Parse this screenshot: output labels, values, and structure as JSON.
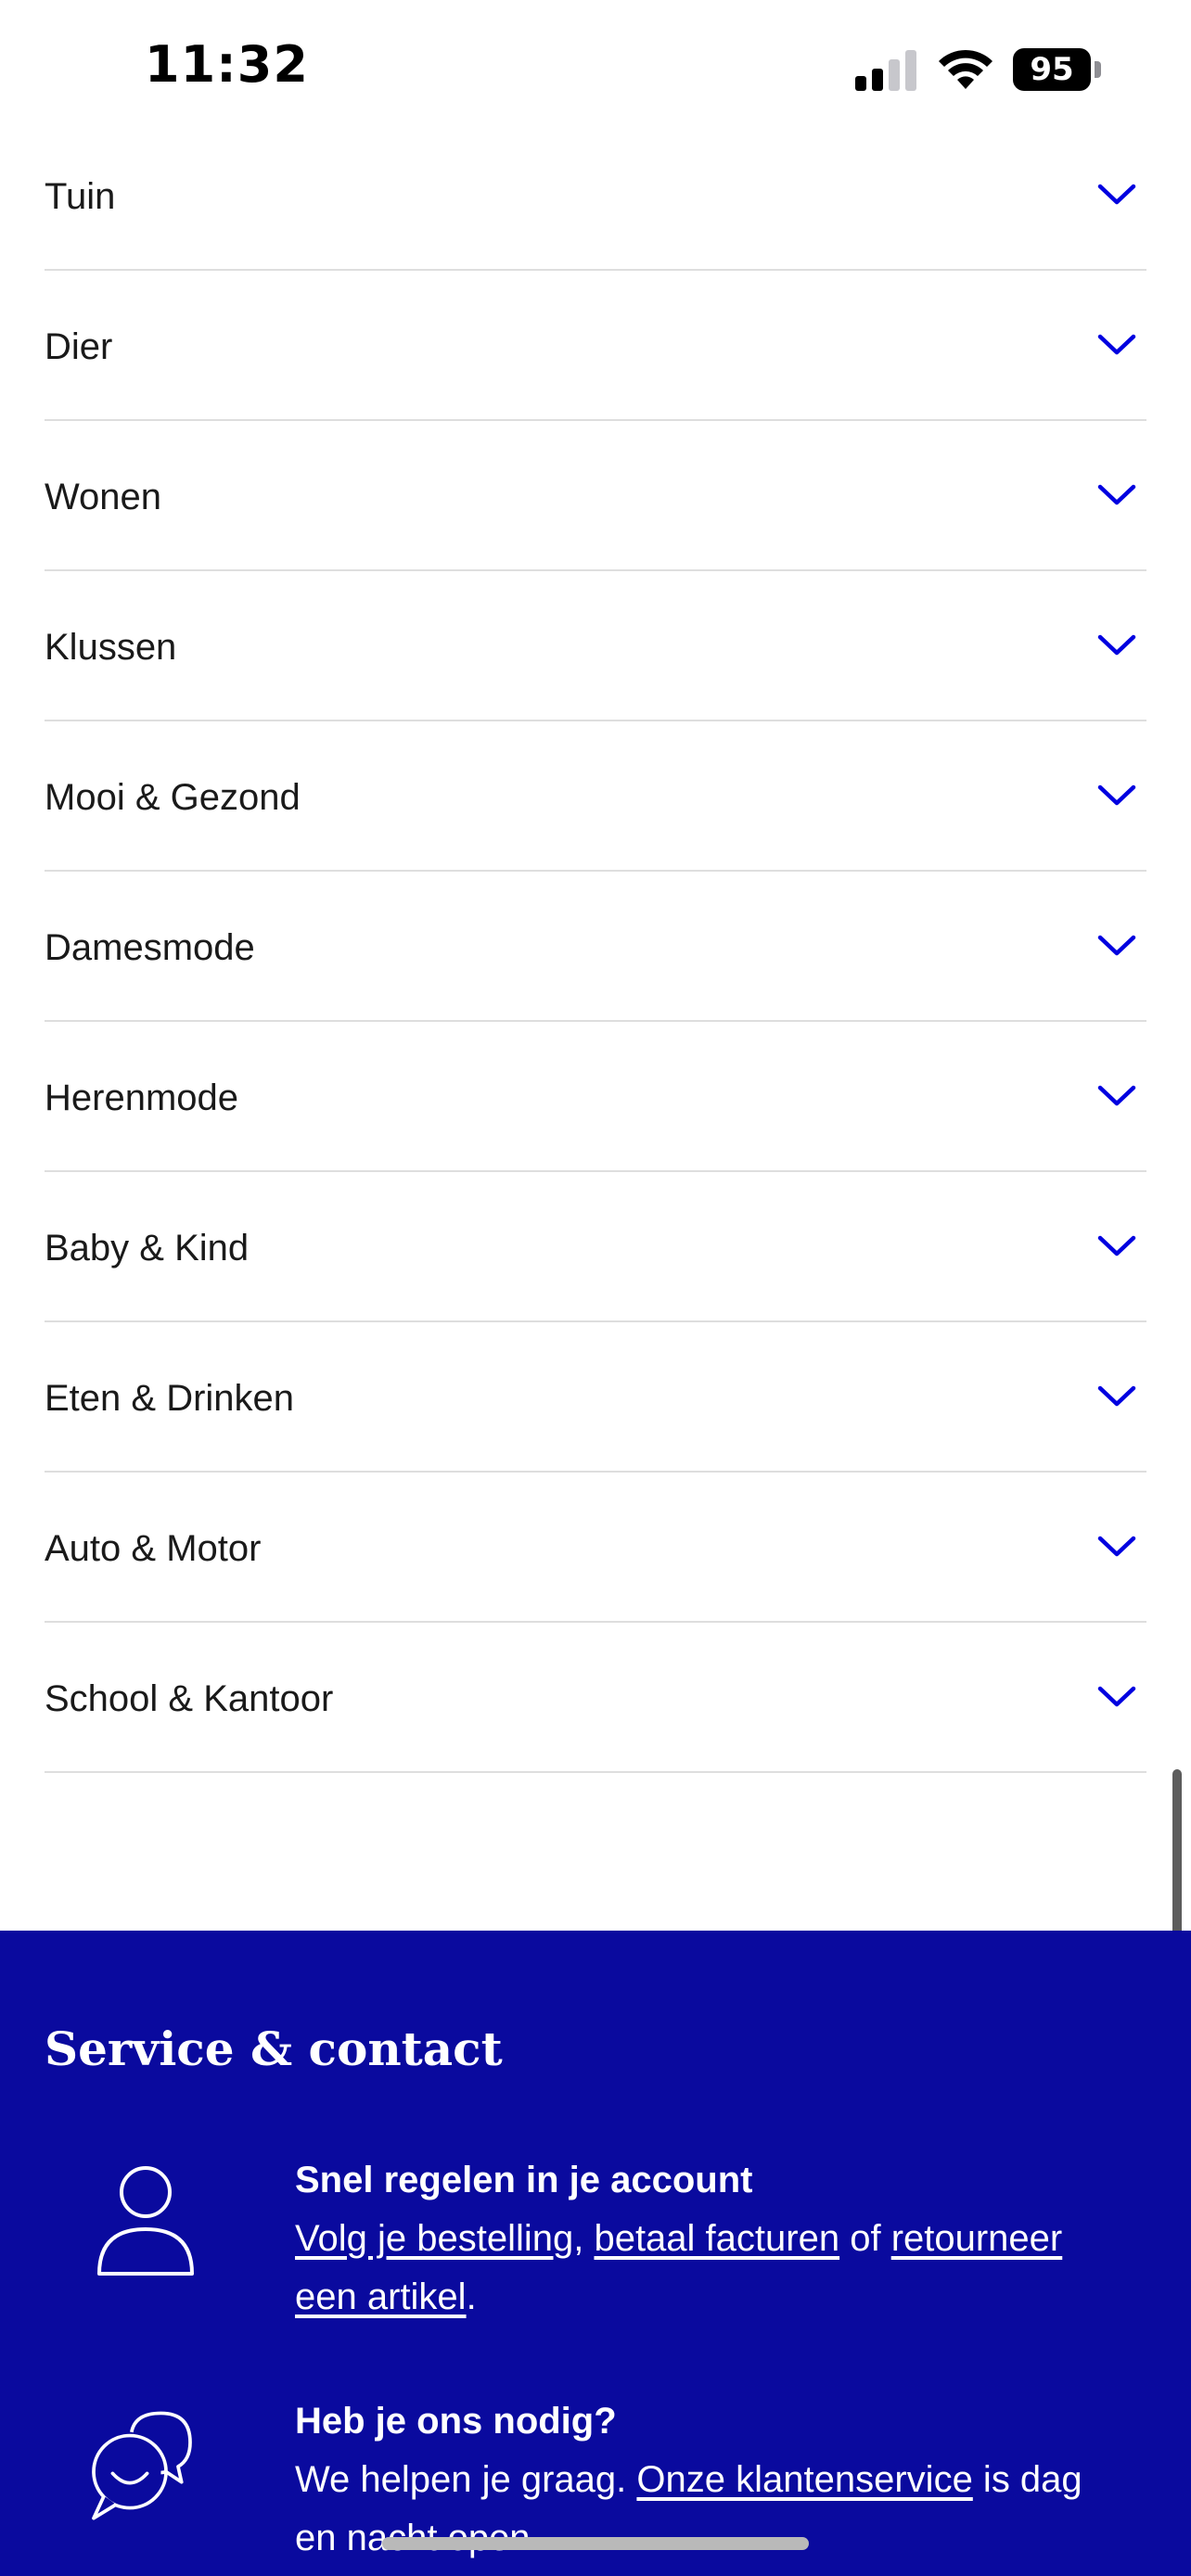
{
  "status_bar": {
    "time": "11:32",
    "battery": "95"
  },
  "categories": [
    {
      "label": "Tuin"
    },
    {
      "label": "Dier"
    },
    {
      "label": "Wonen"
    },
    {
      "label": "Klussen"
    },
    {
      "label": "Mooi & Gezond"
    },
    {
      "label": "Damesmode"
    },
    {
      "label": "Herenmode"
    },
    {
      "label": "Baby & Kind"
    },
    {
      "label": "Eten & Drinken"
    },
    {
      "label": "Auto & Motor"
    },
    {
      "label": "School & Kantoor"
    }
  ],
  "service": {
    "title": "Service & contact",
    "account": {
      "heading": "Snel regelen in je account",
      "link_track": "Volg je bestelling",
      "sep1": ", ",
      "link_pay": "betaal facturen",
      "text_of": " of ",
      "link_return": "retourneer een artikel",
      "end": "."
    },
    "help": {
      "heading": "Heb je ons nodig?",
      "text_before": "We helpen je graag. ",
      "link_service": "Onze klantenservice",
      "text_after": " is dag en nacht open."
    }
  },
  "colors": {
    "accent": "#0a0a9e",
    "chevron": "#0000e0",
    "divider": "#dedede"
  },
  "icons": {
    "chevron": "chevron-down-icon",
    "account": "user-icon",
    "help": "chat-bubbles-icon"
  }
}
